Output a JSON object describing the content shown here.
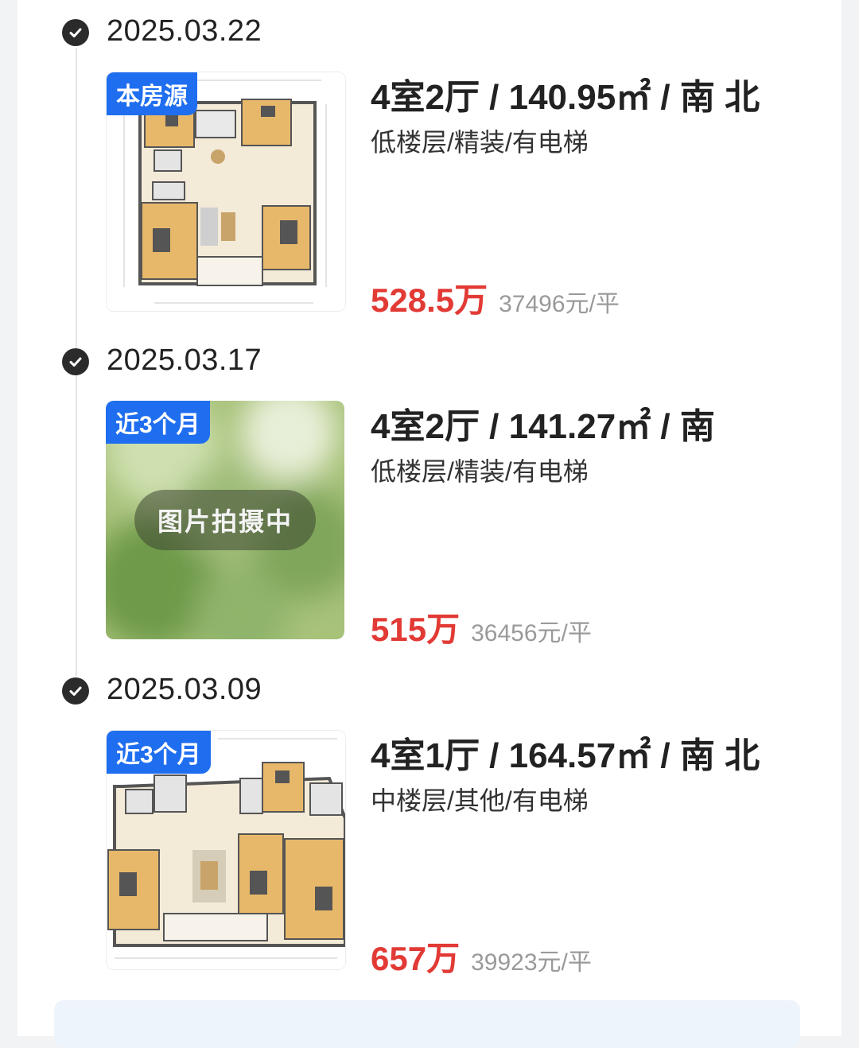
{
  "records": [
    {
      "date": "2025.03.22",
      "badge": "本房源",
      "title": "4室2厅 / 140.95㎡ / 南 北",
      "subtitle": "低楼层/精装/有电梯",
      "price": "528.5万",
      "unit_price": "37496元/平",
      "thumbnail": "floorplan"
    },
    {
      "date": "2025.03.17",
      "badge": "近3个月",
      "title": "4室2厅 / 141.27㎡ / 南",
      "subtitle": "低楼层/精装/有电梯",
      "price": "515万",
      "unit_price": "36456元/平",
      "thumbnail": "placeholder",
      "placeholder_text": "图片拍摄中"
    },
    {
      "date": "2025.03.09",
      "badge": "近3个月",
      "title": "4室1厅 / 164.57㎡ / 南 北",
      "subtitle": "中楼层/其他/有电梯",
      "price": "657万",
      "unit_price": "39923元/平",
      "thumbnail": "floorplan"
    }
  ],
  "colors": {
    "accent_badge": "#1f6ef0",
    "price_red": "#e23a35",
    "check_dark": "#2b2b2b"
  },
  "icons": [
    "check-circle-icon"
  ]
}
